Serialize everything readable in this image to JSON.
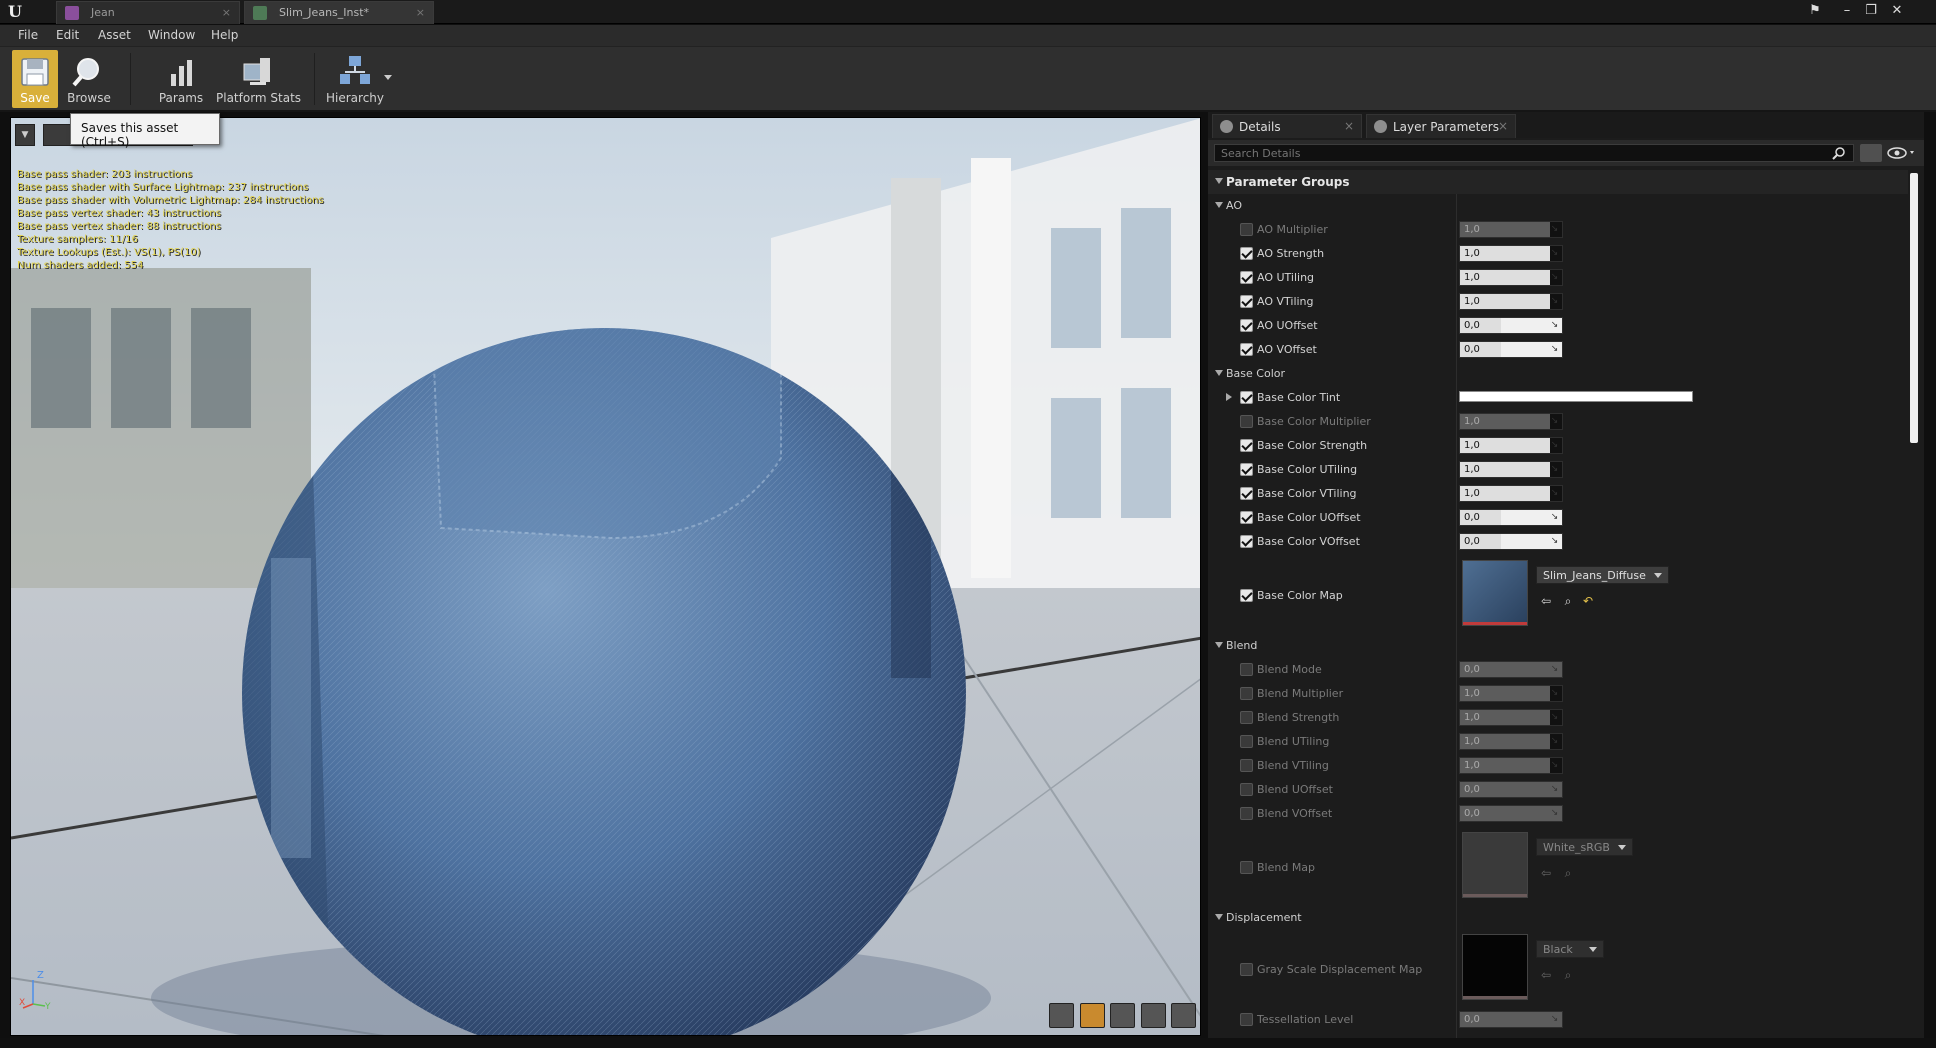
{
  "tabs": [
    {
      "label": "Jean",
      "active": false
    },
    {
      "label": "Slim_Jeans_Inst*",
      "active": true
    }
  ],
  "menu": [
    "File",
    "Edit",
    "Asset",
    "Window",
    "Help"
  ],
  "toolbar": {
    "save_label": "Save",
    "browse_label": "Browse",
    "params_label": "Params",
    "platform_stats_label": "Platform Stats",
    "hierarchy_label": "Hierarchy"
  },
  "tooltip": "Saves this asset (Ctrl+S)",
  "viewport": {
    "stats": [
      "Base pass shader: 203 instructions",
      "Base pass shader with Surface Lightmap: 237 instructions",
      "Base pass shader with Volumetric Lightmap: 284 instructions",
      "Base pass vertex shader: 43 instructions",
      "Base pass vertex shader: 88 instructions",
      "Texture samplers: 11/16",
      "Texture Lookups (Est.): VS(1), PS(10)",
      "Num shaders added: 554"
    ],
    "axis_z": "Z",
    "axis_x": "X",
    "axis_y": "Y"
  },
  "details": {
    "tabs": [
      "Details",
      "Layer Parameters"
    ],
    "search_placeholder": "Search Details",
    "param_groups_label": "Parameter Groups",
    "groups": [
      {
        "name": "AO",
        "params": [
          {
            "label": "AO Multiplier",
            "value": "1,0",
            "enabled": false
          },
          {
            "label": "AO Strength",
            "value": "1,0",
            "enabled": true
          },
          {
            "label": "AO UTiling",
            "value": "1,0",
            "enabled": true
          },
          {
            "label": "AO VTiling",
            "value": "1,0",
            "enabled": true
          },
          {
            "label": "AO UOffset",
            "value": "0,0",
            "enabled": true
          },
          {
            "label": "AO VOffset",
            "value": "0,0",
            "enabled": true
          }
        ]
      },
      {
        "name": "Base Color",
        "params": [
          {
            "label": "Base Color Tint",
            "value": "",
            "enabled": true,
            "kind": "color"
          },
          {
            "label": "Base Color Multiplier",
            "value": "1,0",
            "enabled": false
          },
          {
            "label": "Base Color Strength",
            "value": "1,0",
            "enabled": true
          },
          {
            "label": "Base Color UTiling",
            "value": "1,0",
            "enabled": true
          },
          {
            "label": "Base Color VTiling",
            "value": "1,0",
            "enabled": true
          },
          {
            "label": "Base Color UOffset",
            "value": "0,0",
            "enabled": true
          },
          {
            "label": "Base Color VOffset",
            "value": "0,0",
            "enabled": true
          }
        ],
        "texture": {
          "label": "Base Color Map",
          "asset": "Slim_Jeans_Diffuse",
          "enabled": true
        }
      },
      {
        "name": "Blend",
        "params": [
          {
            "label": "Blend Mode",
            "value": "0,0",
            "enabled": false
          },
          {
            "label": "Blend Multiplier",
            "value": "1,0",
            "enabled": false
          },
          {
            "label": "Blend Strength",
            "value": "1,0",
            "enabled": false
          },
          {
            "label": "Blend UTiling",
            "value": "1,0",
            "enabled": false
          },
          {
            "label": "Blend VTiling",
            "value": "1,0",
            "enabled": false
          },
          {
            "label": "Blend UOffset",
            "value": "0,0",
            "enabled": false
          },
          {
            "label": "Blend VOffset",
            "value": "0,0",
            "enabled": false
          }
        ],
        "texture": {
          "label": "Blend Map",
          "asset": "White_sRGB",
          "enabled": false
        }
      },
      {
        "name": "Displacement",
        "texture": {
          "label": "Gray Scale Displacement Map",
          "asset": "Black",
          "enabled": false
        },
        "params_after": [
          {
            "label": "Tessellation Level",
            "value": "0,0",
            "enabled": false
          }
        ]
      }
    ]
  },
  "colors": {
    "save_accent": "#d9b03a",
    "stats_text": "#e3d34a",
    "panel_bg": "#1c1c1c"
  }
}
